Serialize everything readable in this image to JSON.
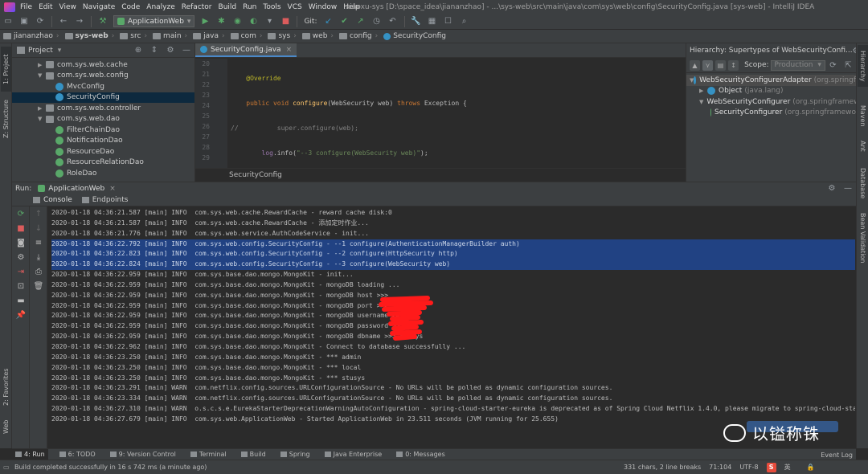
{
  "menu": {
    "items": [
      "File",
      "Edit",
      "View",
      "Navigate",
      "Code",
      "Analyze",
      "Refactor",
      "Build",
      "Run",
      "Tools",
      "VCS",
      "Window",
      "Help"
    ],
    "window_title": "xiaoxu-sys [D:\\space_idea\\jiananzhao] - ...\\sys-web\\src\\main\\java\\com\\sys\\web\\config\\SecurityConfig.java [sys-web] - IntelliJ IDEA"
  },
  "toolbar": {
    "run_config": "ApplicationWeb",
    "git_label": "Git:"
  },
  "breadcrumbs": [
    "jiananzhao",
    "sys-web",
    "src",
    "main",
    "java",
    "com",
    "sys",
    "web",
    "config",
    "SecurityConfig"
  ],
  "left_tabs": {
    "project": "1: Project",
    "structure": "Z: Structure",
    "favorites": "2: Favorites",
    "web": "Web"
  },
  "right_tabs": {
    "hierarchy": "Hierarchy",
    "maven": "Maven",
    "ant": "Ant",
    "database": "Database",
    "bean": "Bean Validation"
  },
  "project_panel": {
    "title": "Project",
    "items": [
      {
        "label": "com.sys.web.cache",
        "type": "package",
        "indent": 1,
        "arrow": "▶"
      },
      {
        "label": "com.sys.web.config",
        "type": "package",
        "indent": 1,
        "arrow": "▼"
      },
      {
        "label": "MvcConfig",
        "type": "class",
        "indent": 2,
        "arrow": ""
      },
      {
        "label": "SecurityConfig",
        "type": "class",
        "indent": 2,
        "arrow": "",
        "selected": true
      },
      {
        "label": "com.sys.web.controller",
        "type": "package",
        "indent": 1,
        "arrow": "▶"
      },
      {
        "label": "com.sys.web.dao",
        "type": "package",
        "indent": 1,
        "arrow": "▼"
      },
      {
        "label": "FilterChainDao",
        "type": "interface",
        "indent": 2,
        "arrow": ""
      },
      {
        "label": "NotificationDao",
        "type": "interface",
        "indent": 2,
        "arrow": ""
      },
      {
        "label": "ResourceDao",
        "type": "interface",
        "indent": 2,
        "arrow": ""
      },
      {
        "label": "ResourceRelationDao",
        "type": "interface",
        "indent": 2,
        "arrow": ""
      },
      {
        "label": "RoleDao",
        "type": "interface",
        "indent": 2,
        "arrow": ""
      }
    ]
  },
  "editor": {
    "tab": "SecurityConfig.java",
    "breadcrumb": "SecurityConfig",
    "line_numbers": [
      "20",
      "21",
      "22",
      "23",
      "24",
      "25",
      "26",
      "27",
      "28",
      "29"
    ]
  },
  "hierarchy": {
    "title": "Hierarchy:  Supertypes of WebSecurityConfi...",
    "scope_label": "Scope:",
    "scope_value": "Production",
    "rows": [
      {
        "label": "WebSecurityConfigurerAdapter",
        "pkg": "(org.springf",
        "arrow": "▼",
        "indent": 0,
        "color": "#3592c4",
        "selected": true
      },
      {
        "label": "Object",
        "pkg": "(java.lang)",
        "arrow": "▶",
        "indent": 1,
        "color": "#3592c4"
      },
      {
        "label": "WebSecurityConfigurer",
        "pkg": "(org.springframew",
        "arrow": "▼",
        "indent": 1,
        "color": "#59a869"
      },
      {
        "label": "SecurityConfigurer",
        "pkg": "(org.springframewo",
        "arrow": "",
        "indent": 2,
        "color": "#59a869"
      }
    ]
  },
  "run_panel": {
    "label": "Run:",
    "tab": "ApplicationWeb",
    "subtabs": [
      "Console",
      "Endpoints"
    ],
    "lines": [
      {
        "text": "2020-01-18 04:36:21.587 [main] INFO  com.sys.web.cache.RewardCache - reward cache disk:0"
      },
      {
        "text": "2020-01-18 04:36:21.587 [main] INFO  com.sys.web.cache.RewardCache - 添加定时作业..."
      },
      {
        "text": "2020-01-18 04:36:21.776 [main] INFO  com.sys.web.service.AuthCodeService - init..."
      },
      {
        "text": "2020-01-18 04:36:22.792 [main] INFO  com.sys.web.config.SecurityConfig - --1 configure(AuthenticationManagerBuilder auth)",
        "selected": true
      },
      {
        "text": "2020-01-18 04:36:22.823 [main] INFO  com.sys.web.config.SecurityConfig - --2 configure(HttpSecurity http)",
        "selected": true
      },
      {
        "text": "2020-01-18 04:36:22.824 [main] INFO  com.sys.web.config.SecurityConfig - --3 configure(WebSecurity web)",
        "selected": true
      },
      {
        "text": "2020-01-18 04:36:22.959 [main] INFO  com.sys.base.dao.mongo.MongoKit - init..."
      },
      {
        "text": "2020-01-18 04:36:22.959 [main] INFO  com.sys.base.dao.mongo.MongoKit - mongoDB loading ..."
      },
      {
        "text": "2020-01-18 04:36:22.959 [main] INFO  com.sys.base.dao.mongo.MongoKit - mongoDB host >>>"
      },
      {
        "text": "2020-01-18 04:36:22.959 [main] INFO  com.sys.base.dao.mongo.MongoKit - mongoDB port >>>"
      },
      {
        "text": "2020-01-18 04:36:22.959 [main] INFO  com.sys.base.dao.mongo.MongoKit - mongoDB username >>>"
      },
      {
        "text": "2020-01-18 04:36:22.959 [main] INFO  com.sys.base.dao.mongo.MongoKit - mongoDB password >>>"
      },
      {
        "text": "2020-01-18 04:36:22.959 [main] INFO  com.sys.base.dao.mongo.MongoKit - mongoDB dbname >>> stusys"
      },
      {
        "text": "2020-01-18 04:36:22.962 [main] INFO  com.sys.base.dao.mongo.MongoKit - Connect to database successfully ..."
      },
      {
        "text": "2020-01-18 04:36:23.250 [main] INFO  com.sys.base.dao.mongo.MongoKit - *** admin"
      },
      {
        "text": "2020-01-18 04:36:23.250 [main] INFO  com.sys.base.dao.mongo.MongoKit - *** local"
      },
      {
        "text": "2020-01-18 04:36:23.250 [main] INFO  com.sys.base.dao.mongo.MongoKit - *** stusys"
      },
      {
        "text": "2020-01-18 04:36:23.291 [main] WARN  com.netflix.config.sources.URLConfigurationSource - No URLs will be polled as dynamic configuration sources."
      },
      {
        "text": "2020-01-18 04:36:23.334 [main] WARN  com.netflix.config.sources.URLConfigurationSource - No URLs will be polled as dynamic configuration sources."
      },
      {
        "text": "2020-01-18 04:36:27.310 [main] WARN  o.s.c.s.e.EurekaStarterDeprecationWarningAutoConfiguration - spring-cloud-starter-eureka is deprecated as of Spring Cloud Netflix 1.4.0, please migrate to spring-cloud-starter-netflix-eu"
      },
      {
        "text": "2020-01-18 04:36:27.679 [main] INFO  com.sys.web.ApplicationWeb - Started ApplicationWeb in 23.511 seconds (JVM running for 25.655)"
      }
    ]
  },
  "bottom_tabs": [
    {
      "label": "4: Run",
      "active": true
    },
    {
      "label": "6: TODO"
    },
    {
      "label": "9: Version Control"
    },
    {
      "label": "Terminal"
    },
    {
      "label": "Build"
    },
    {
      "label": "Spring"
    },
    {
      "label": "Java Enterprise"
    },
    {
      "label": "0: Messages"
    }
  ],
  "event_log": "Event Log",
  "status": {
    "message": "Build completed successfully in 16 s 742 ms (a minute ago)",
    "chars": "331 chars, 2 line breaks",
    "position": "71:104",
    "encoding": "UTF-8",
    "ime": "英"
  },
  "watermark": "以镒称铢",
  "colors": {
    "selection": "#214283",
    "accent": "#4a88c7",
    "run_green": "#59a869",
    "stop_red": "#db5c5c"
  }
}
